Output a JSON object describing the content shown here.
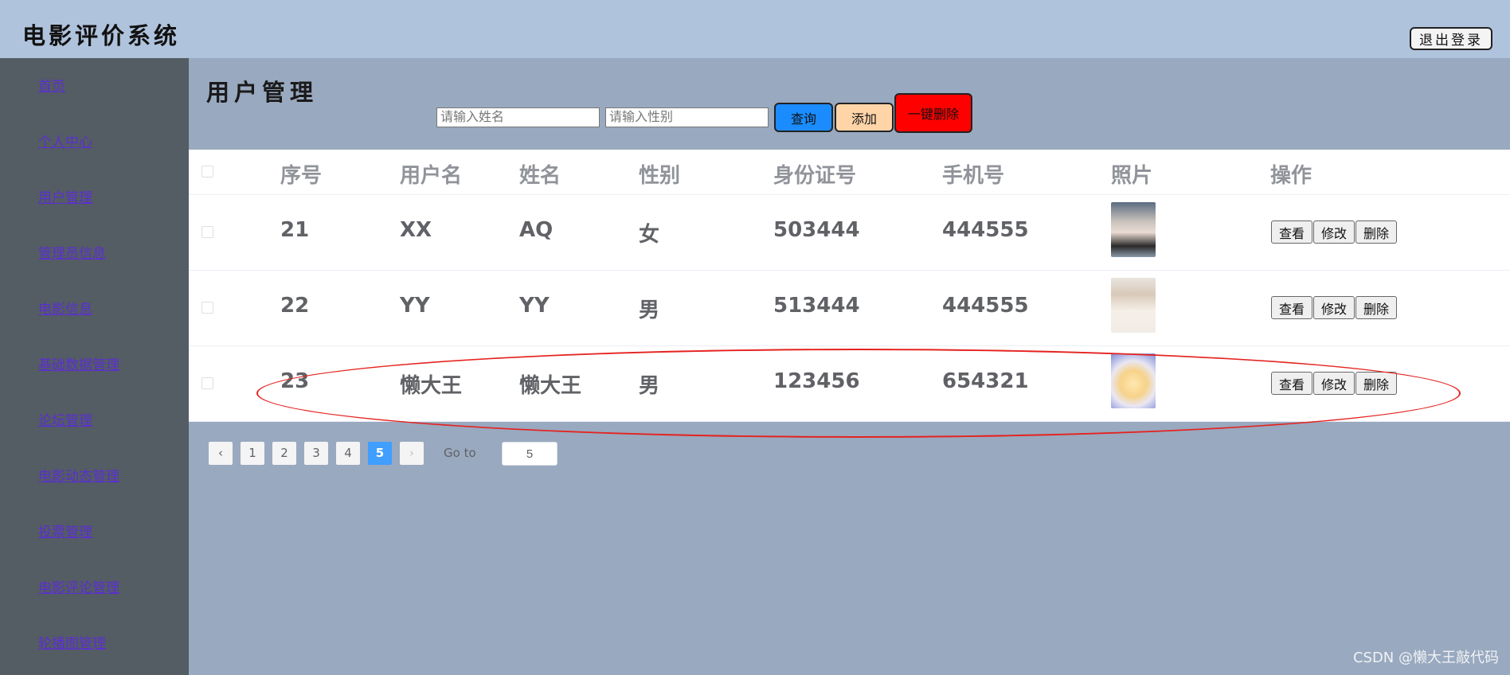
{
  "header": {
    "app_title": "电影评价系统",
    "logout_label": "退出登录"
  },
  "sidebar": {
    "items": [
      {
        "label": "首页"
      },
      {
        "label": "个人中心"
      },
      {
        "label": "用户管理"
      },
      {
        "label": "管理员信息"
      },
      {
        "label": "电影信息"
      },
      {
        "label": "基础数据管理"
      },
      {
        "label": "论坛管理"
      },
      {
        "label": "电影动态管理"
      },
      {
        "label": "投票管理"
      },
      {
        "label": "电影评论管理"
      },
      {
        "label": "轮播图管理"
      }
    ]
  },
  "main": {
    "title": "用户管理",
    "search": {
      "name_placeholder": "请输入姓名",
      "gender_placeholder": "请输入性别"
    },
    "buttons": {
      "query": "查询",
      "add": "添加",
      "bulk_delete": "一键删除"
    },
    "table": {
      "headers": [
        "序号",
        "用户名",
        "姓名",
        "性别",
        "身份证号",
        "手机号",
        "照片",
        "操作"
      ],
      "rows": [
        {
          "id": "21",
          "username": "XX",
          "name": "AQ",
          "gender": "女",
          "id_card": "503444",
          "phone": "444555"
        },
        {
          "id": "22",
          "username": "YY",
          "name": "YY",
          "gender": "男",
          "id_card": "513444",
          "phone": "444555"
        },
        {
          "id": "23",
          "username": "懒大王",
          "name": "懒大王",
          "gender": "男",
          "id_card": "123456",
          "phone": "654321"
        }
      ],
      "actions": {
        "view": "查看",
        "edit": "修改",
        "delete": "删除"
      }
    },
    "pagination": {
      "prev_icon": "‹",
      "next_icon": "›",
      "pages": [
        "1",
        "2",
        "3",
        "4",
        "5"
      ],
      "current": "5",
      "goto_label": "Go to",
      "goto_value": "5"
    }
  },
  "watermark": "CSDN @懒大王敲代码",
  "colors": {
    "topbar": "#b0c3dd",
    "sidebar": "#545c64",
    "main_bg": "#99a9bf",
    "query_button": "#1a8cff",
    "add_button": "#ffd5a8",
    "bulk_delete_button": "#ff0000",
    "highlight_ellipse": "#e5221f",
    "active_page": "#409eff"
  }
}
